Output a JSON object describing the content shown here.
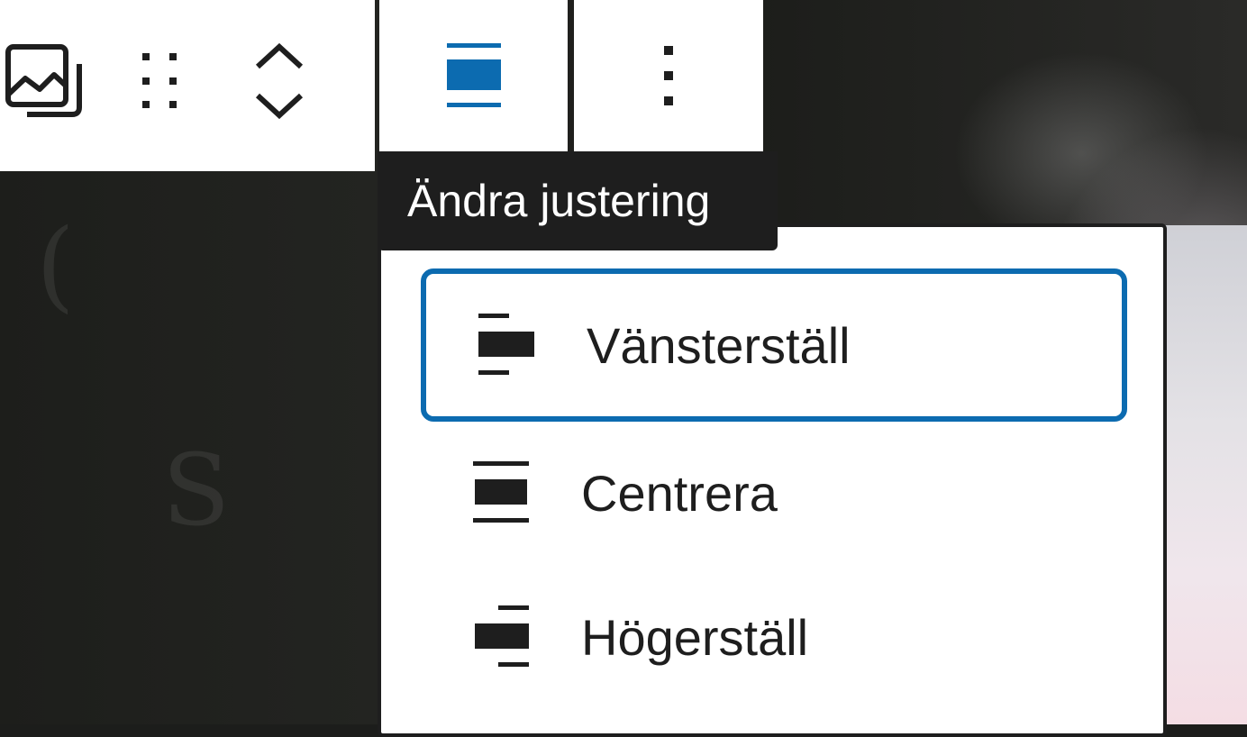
{
  "toolbar": {
    "icons": {
      "block_type": "gallery-image-icon",
      "drag": "drag-handle-icon",
      "move": "move-up-down-icon",
      "align": "align-center-icon",
      "more": "more-vertical-icon"
    },
    "accent_color": "#0c6bb0"
  },
  "tooltip": {
    "text": "Ändra justering"
  },
  "align_menu": {
    "items": [
      {
        "label": "Vänsterställ",
        "icon": "align-left-icon",
        "selected": true
      },
      {
        "label": "Centrera",
        "icon": "align-center-icon",
        "selected": false
      },
      {
        "label": "Högerställ",
        "icon": "align-right-icon",
        "selected": false
      }
    ]
  }
}
